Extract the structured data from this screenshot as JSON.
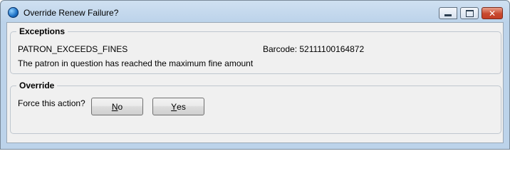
{
  "window": {
    "title": "Override Renew Failure?"
  },
  "exceptions": {
    "legend": "Exceptions",
    "code": "PATRON_EXCEEDS_FINES",
    "barcode": "Barcode: 52111100164872",
    "message": "The patron in question has reached the maximum fine amount"
  },
  "override": {
    "legend": "Override",
    "prompt": "Force this action?",
    "no_button": {
      "mnemonic": "N",
      "rest": "o"
    },
    "yes_button": {
      "mnemonic": "Y",
      "rest": "es"
    }
  },
  "icons": {
    "app": "globe-icon",
    "minimize": "minimize-icon",
    "maximize": "maximize-icon",
    "close": "close-icon"
  },
  "colors": {
    "close_button": "#c8492f",
    "titlebar": "#cfe0f1",
    "client": "#f0f0f0"
  }
}
